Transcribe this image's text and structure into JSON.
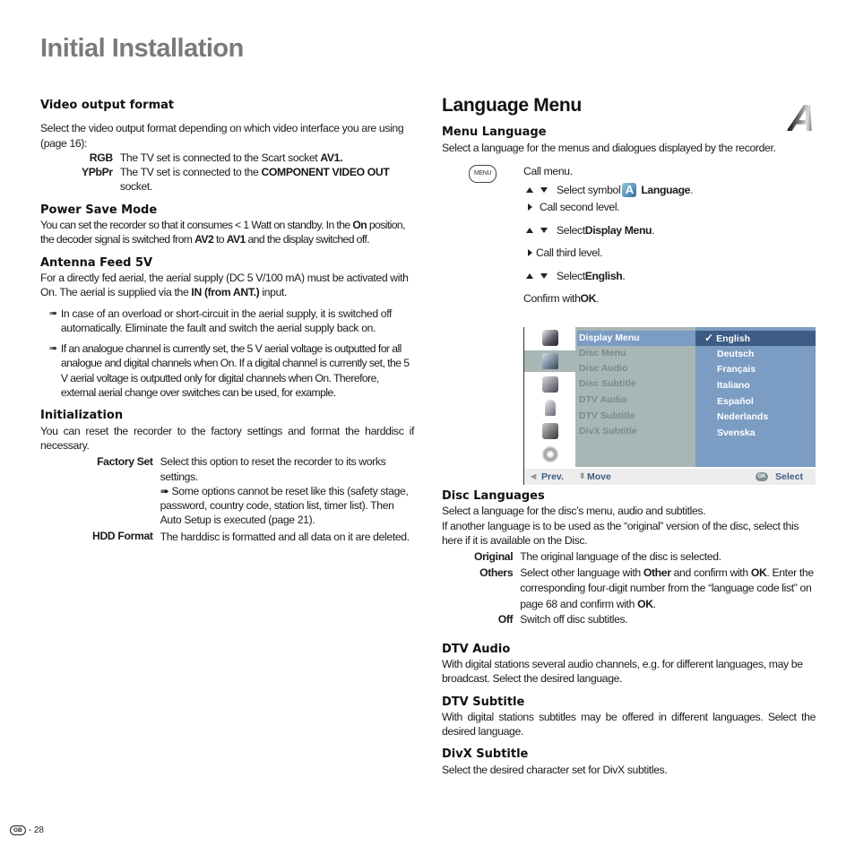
{
  "page_title": "Initial Installation",
  "left": {
    "video_output": {
      "heading": "Video output format",
      "intro": "Select the video output format depending on which video interface you are using (page 16):",
      "items": [
        {
          "term": "RGB",
          "text_pre": "The TV set is connected to the Scart socket ",
          "bold": "AV1.",
          "text_post": ""
        },
        {
          "term": "YPbPr",
          "text_pre": "The TV set is connected to the ",
          "bold": "COMPONENT VIDEO OUT",
          "text_post": " socket."
        }
      ]
    },
    "power_save": {
      "heading": "Power Save Mode",
      "t1": "You can set the recorder so that it consumes < 1 Watt on standby. In the ",
      "b1": "On",
      "t2": " position, the decoder signal is switched from ",
      "b2": "AV2",
      "t3": " to ",
      "b3": "AV1",
      "t4": " and the display switched off."
    },
    "antenna": {
      "heading": "Antenna Feed 5V",
      "t1": "For a directly fed aerial, the aerial supply (DC 5 V/100 mA) must be activated with On. The aerial is supplied via the ",
      "b1": "IN (from ANT.)",
      "t2": " input.",
      "notes": [
        "In case of an overload or short-circuit in the aerial supply, it is switched off automatically. Eliminate the fault and switch the aerial supply back on.",
        "If an analogue channel is currently set, the 5 V aerial voltage is outputted for all analogue and digital channels when On. If a digital channel is currently set, the 5 V aerial voltage is outputted only for digital channels when On. Therefore, external aerial change over switches can be used, for example."
      ]
    },
    "initialization": {
      "heading": "Initialization",
      "intro": "You can reset the recorder to the factory settings and format the harddisc if necessary.",
      "factory_term": "Factory Set",
      "factory_text": "Select this option to reset the recorder to its works settings.",
      "factory_note": "Some options cannot be reset like this (safety stage, password, country code, station list, timer list). Then Auto Setup is executed (page 21).",
      "hdd_term": "HDD Format",
      "hdd_text": "The harddisc is formatted and all data on it are deleted."
    }
  },
  "right": {
    "heading": "Language Menu",
    "menu_language": {
      "heading": "Menu Language",
      "intro": "Select a language for the menus and dialogues displayed by the recorder.",
      "menu_key": "MENU",
      "steps": {
        "call_menu": "Call menu.",
        "select_symbol_pre": "Select symbol ",
        "select_symbol_bold": "Language",
        "call_second": "Call second level.",
        "select_display_pre": "Select ",
        "select_display_bold": "Display Menu",
        "call_third": "Call third level.",
        "select_english_pre": "Select ",
        "select_english_bold": "English",
        "confirm_pre": "Confirm with ",
        "confirm_bold": "OK"
      }
    },
    "osd": {
      "second_level": [
        "Display Menu",
        "Disc Menu",
        "Disc Audio",
        "Disc Subtitle",
        "DTV Audio",
        "DTV Subtitle",
        "DivX Subtitle"
      ],
      "languages": [
        "English",
        "Deutsch",
        "Français",
        "Italiano",
        "Español",
        "Nederlands",
        "Svenska"
      ],
      "check": "✓",
      "footer": {
        "prev": "Prev.",
        "move": "Move",
        "ok_badge": "OK",
        "select": "Select"
      },
      "colors": {
        "mid_bg": "#a8b6b5",
        "right_bg": "#7b9cc3",
        "selected_bg": "#3c5c85"
      }
    },
    "disc_languages": {
      "heading": "Disc Languages",
      "p1": "Select a language for the disc’s menu, audio and subtitles.",
      "p2": "If another language is to be used as the “original” version of the disc, select this here if it is available on the Disc.",
      "original_term": "Original",
      "original_text": "The original language of the disc is selected.",
      "others_term": "Others",
      "others_t1": "Select other language with ",
      "others_b1": "Other",
      "others_t2": " and confirm with ",
      "others_b2": "OK",
      "others_t3": ". Enter the corresponding four-digit number from the “language code list” on page 68 and confirm with ",
      "others_b3": "OK",
      "others_t4": ".",
      "off_term": "Off",
      "off_text": "Switch off disc subtitles."
    },
    "dtv_audio": {
      "heading": "DTV Audio",
      "text": "With digital stations several audio channels, e.g. for different languages, may be broadcast. Select the desired language."
    },
    "dtv_subtitle": {
      "heading": "DTV Subtitle",
      "text": "With digital stations subtitles may be offered in different languages. Select the desired language."
    },
    "divx_subtitle": {
      "heading": "DivX Subtitle",
      "text": "Select the desired character set for DivX subtitles."
    }
  },
  "footer": {
    "country_badge": "GB",
    "page": "- 28"
  }
}
